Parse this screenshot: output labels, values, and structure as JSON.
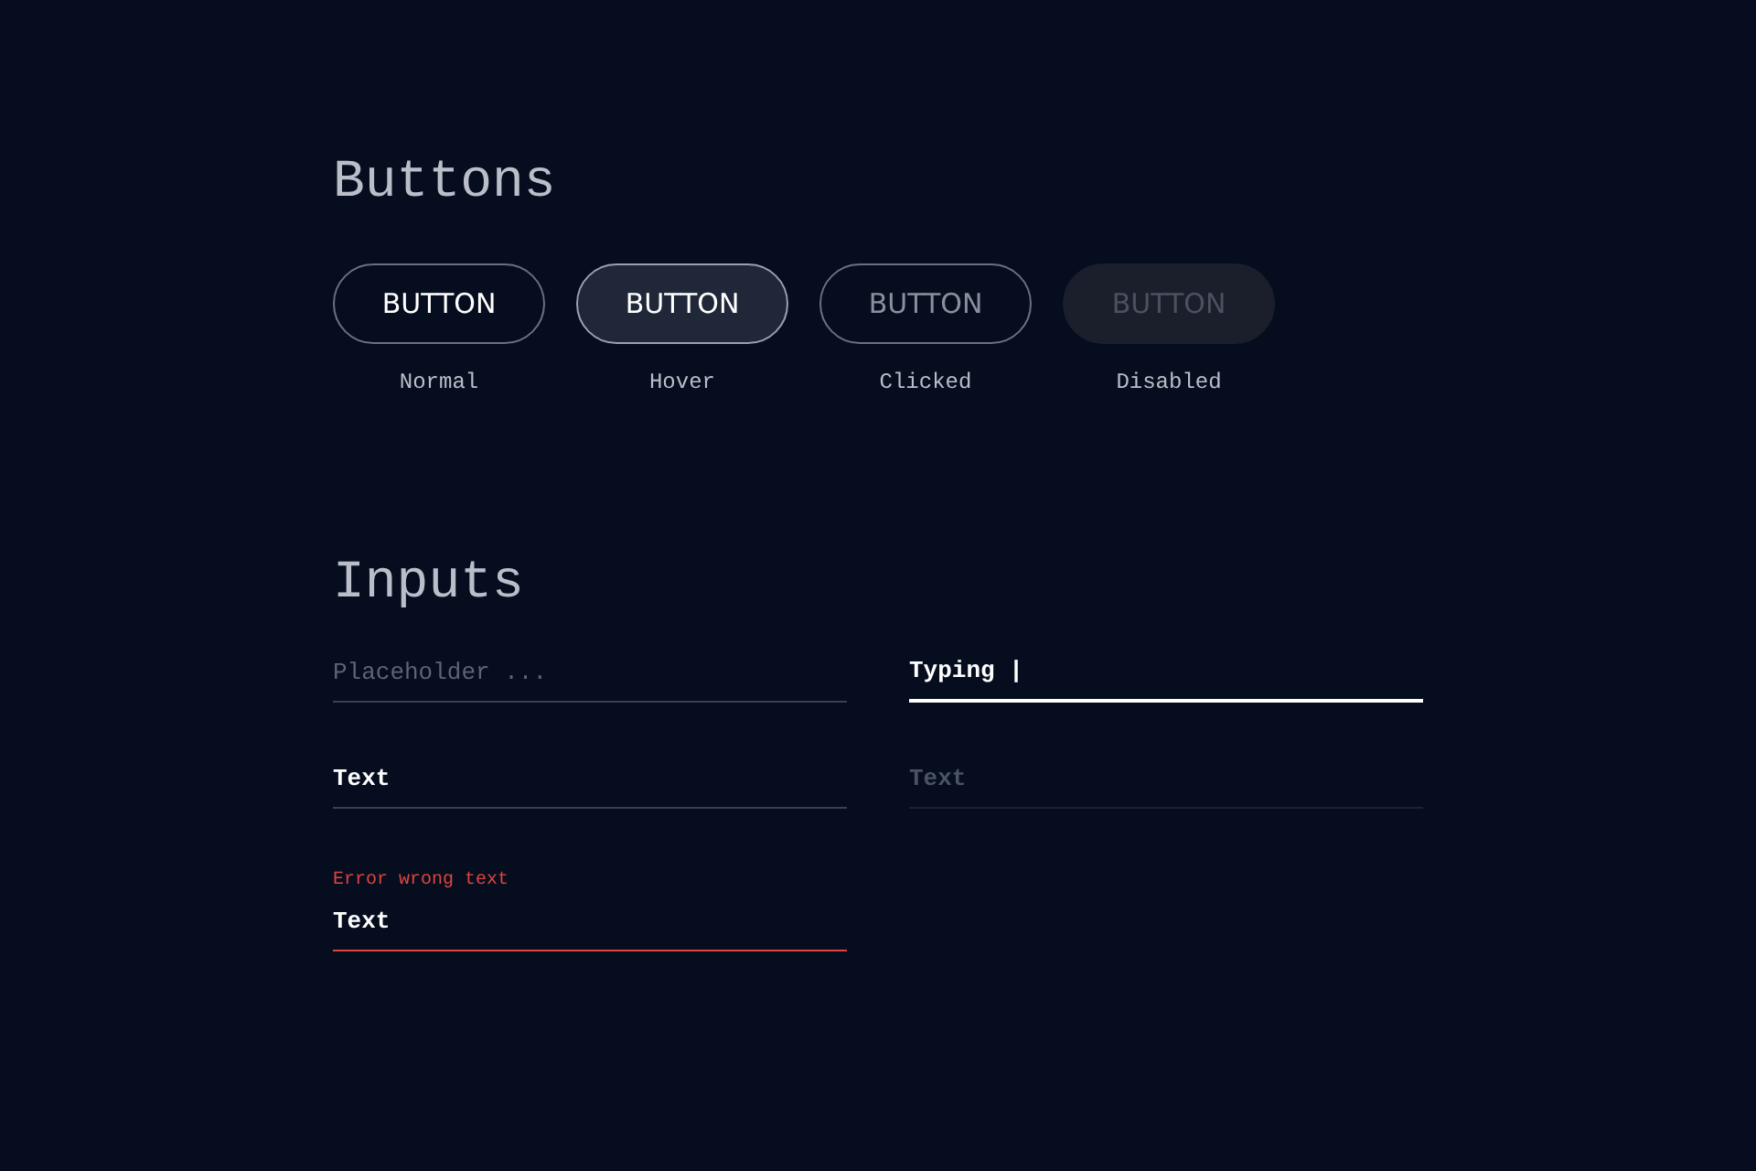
{
  "buttons_section": {
    "title": "Buttons",
    "buttons": [
      {
        "label": "BUTTON",
        "kind": "plain",
        "caption": "Normal"
      },
      {
        "label": "BUTTON",
        "kind": "lit",
        "caption": "Hover"
      },
      {
        "label": "BUTTON",
        "kind": "pressed",
        "caption": "Clicked"
      },
      {
        "label": "BUTTON",
        "kind": "off",
        "caption": "Disabled"
      }
    ]
  },
  "inputs_section": {
    "title": "Inputs",
    "fields": [
      {
        "kind": "placeholder",
        "placeholder": "Placeholder ..."
      },
      {
        "kind": "focused",
        "value": "Typing |"
      },
      {
        "kind": "filled",
        "value": "Text"
      },
      {
        "kind": "disabled",
        "value": "Text"
      },
      {
        "kind": "error",
        "error": "Error wrong text",
        "value": "Text"
      }
    ]
  }
}
